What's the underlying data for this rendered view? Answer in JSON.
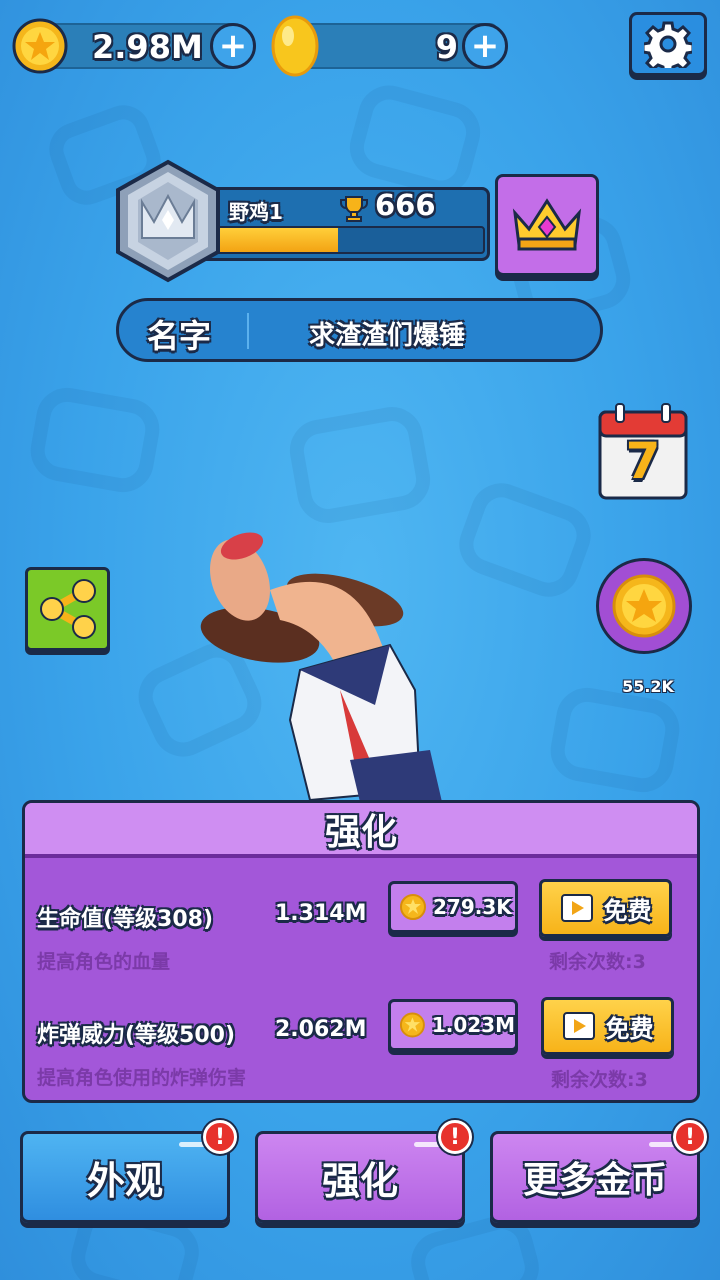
{
  "currency": {
    "coins_value": "2.98M",
    "gems_value": "9"
  },
  "profile": {
    "player_name": "野鸡1",
    "trophies": "666",
    "xp_progress": 0.46
  },
  "name_bar": {
    "label": "名字",
    "value": "求渣渣们爆锤"
  },
  "side": {
    "calendar_day": "7",
    "coin_reward": "55.2K"
  },
  "upgrade_panel": {
    "title": "强化",
    "rows": [
      {
        "title": "生命值(等级308)",
        "value": "1.314M",
        "description": "提高角色的血量",
        "cost": "279.3K",
        "free_label": "免费",
        "remaining": "剩余次数:3"
      },
      {
        "title": "炸弹威力(等级500)",
        "value": "2.062M",
        "description": "提高角色使用的炸弹伤害",
        "cost": "1.023M",
        "free_label": "免费",
        "remaining": "剩余次数:3"
      }
    ]
  },
  "tabs": [
    {
      "label": "外观",
      "alert": "!"
    },
    {
      "label": "强化",
      "alert": "!"
    },
    {
      "label": "更多金币",
      "alert": "!"
    }
  ],
  "colors": {
    "background": "#3aa3ea",
    "outline": "#1b2a48",
    "purple": "#a357d9",
    "gold": "#f7b319",
    "alert": "#e7322c"
  }
}
